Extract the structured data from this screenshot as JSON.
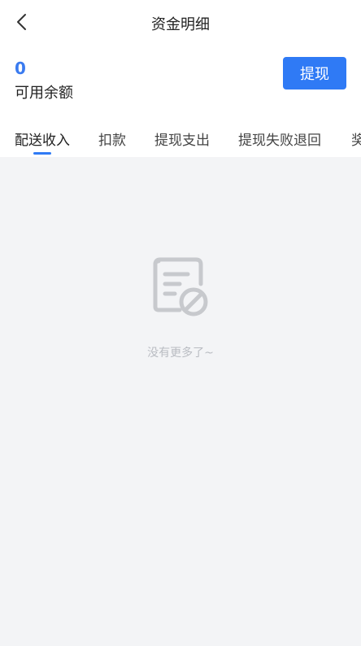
{
  "header": {
    "title": "资金明细",
    "back_icon": "chevron-left-icon"
  },
  "balance": {
    "amount": "0",
    "label": "可用余额",
    "withdraw_label": "提现"
  },
  "tabs": [
    {
      "label": "配送收入",
      "active": true
    },
    {
      "label": "扣款",
      "active": false
    },
    {
      "label": "提现支出",
      "active": false
    },
    {
      "label": "提现失败退回",
      "active": false
    },
    {
      "label": "奖",
      "active": false
    }
  ],
  "empty_state": {
    "icon": "document-blocked-icon",
    "text": "没有更多了~"
  },
  "colors": {
    "accent": "#2f7af5",
    "amount": "#3a7bf0",
    "background": "#f3f4f6",
    "muted": "#b9bcc2"
  }
}
